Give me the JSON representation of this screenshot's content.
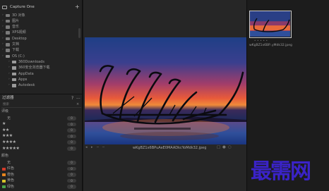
{
  "library": {
    "title": "Capture One",
    "add_button": "+",
    "tree": [
      {
        "label": "3D 对象",
        "icon": "cube-icon",
        "level": 1
      },
      {
        "label": "图片",
        "icon": "image-icon",
        "level": 1
      },
      {
        "label": "音乐",
        "icon": "music-icon",
        "level": 1
      },
      {
        "label": "XPS视频",
        "icon": "video-icon",
        "level": 1
      },
      {
        "label": "Desktop",
        "icon": "desktop-icon",
        "level": 1
      },
      {
        "label": "文档",
        "icon": "document-icon",
        "level": 1
      },
      {
        "label": "下载",
        "icon": "download-icon",
        "level": 1
      },
      {
        "label": "OS (C:)",
        "icon": "drive-icon",
        "level": 1
      },
      {
        "label": "360Downloads",
        "icon": "folder-icon",
        "level": 2
      },
      {
        "label": "360安全浏览器下载",
        "icon": "folder-icon",
        "level": 2
      },
      {
        "label": "AppData",
        "icon": "folder-icon",
        "level": 2
      },
      {
        "label": "Apps",
        "icon": "folder-icon",
        "level": 2
      },
      {
        "label": "Autodesk",
        "icon": "folder-icon",
        "level": 2
      }
    ]
  },
  "filters": {
    "title": "过滤器",
    "help_label": "?",
    "menu_label": "...",
    "search_placeholder": "搜索",
    "rating_section": "评级",
    "rating_rows": [
      {
        "label": "无",
        "stars": "",
        "count": "0"
      },
      {
        "label": "",
        "stars": "★",
        "count": "0"
      },
      {
        "label": "",
        "stars": "★★",
        "count": "0"
      },
      {
        "label": "",
        "stars": "★★★",
        "count": "0"
      },
      {
        "label": "",
        "stars": "★★★★",
        "count": "0"
      },
      {
        "label": "",
        "stars": "★★★★★",
        "count": "0"
      }
    ],
    "color_section": "颜色",
    "color_rows": [
      {
        "label": "无",
        "color": "",
        "count": "0"
      },
      {
        "label": "红色",
        "color": "#d23b2a",
        "count": "0"
      },
      {
        "label": "橙色",
        "color": "#e8851d",
        "count": "0"
      },
      {
        "label": "黄色",
        "color": "#d8c22a",
        "count": "0"
      },
      {
        "label": "绿色",
        "color": "#4aa54a",
        "count": "0"
      }
    ]
  },
  "viewer": {
    "filename": "wKgBZ1x6BPuAeE0MAADkcYoMdk32.jpeg",
    "toolbar_left": [
      "◂",
      "▸",
      "─",
      "─"
    ],
    "toolbar_right": [
      "□",
      "●",
      "○"
    ]
  },
  "browser": {
    "thumbnail_name": "wKgBZ1x6BP..yMdk32.jpeg",
    "thumbnail_stars": "•••••"
  },
  "watermark": "最需网",
  "colors": {
    "panel_bg": "#232323",
    "viewer_bg": "#262626",
    "browser_bg": "#1c1c1c",
    "watermark": "#3a23c8"
  }
}
